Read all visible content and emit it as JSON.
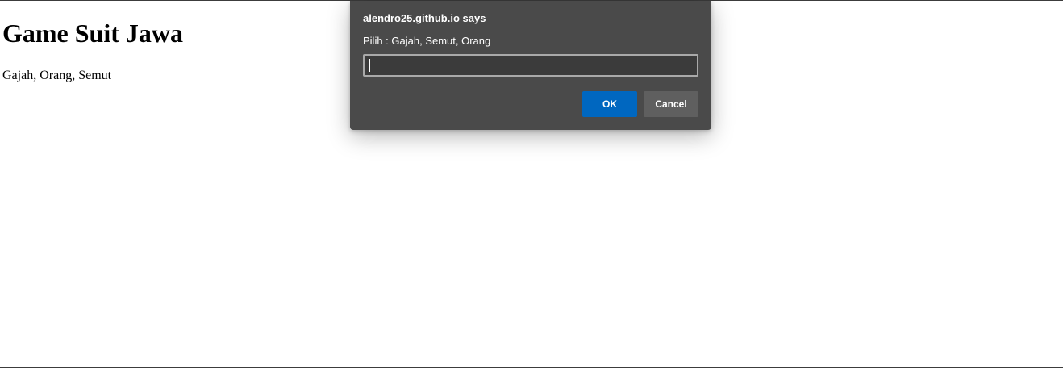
{
  "page": {
    "title": "Game Suit Jawa",
    "text": "Gajah, Orang, Semut"
  },
  "prompt_dialog": {
    "title": "alendro25.github.io says",
    "message": "Pilih : Gajah, Semut, Orang",
    "input_value": "",
    "ok_label": "OK",
    "cancel_label": "Cancel"
  },
  "colors": {
    "dialog_background": "#4a4a4a",
    "ok_button": "#0067c0",
    "cancel_button": "#5f5f5f",
    "input_border": "#a9a9a9"
  }
}
